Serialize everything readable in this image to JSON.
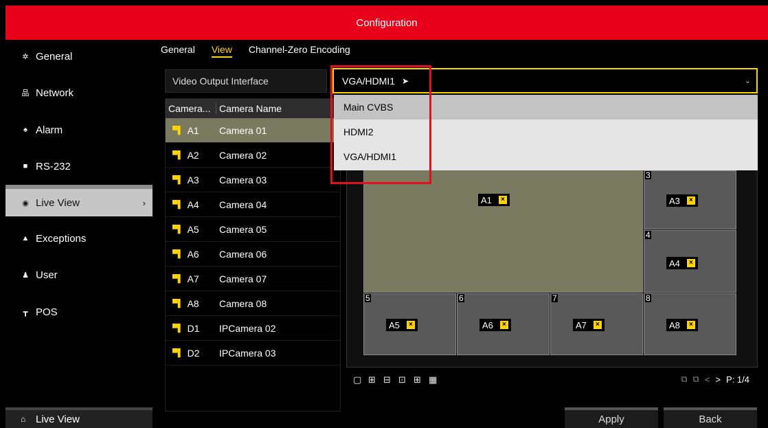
{
  "window": {
    "title": "Configuration"
  },
  "sidebar": {
    "items": [
      {
        "label": "General",
        "icon": "gear-icon"
      },
      {
        "label": "Network",
        "icon": "network-icon"
      },
      {
        "label": "Alarm",
        "icon": "alarm-icon"
      },
      {
        "label": "RS-232",
        "icon": "rs232-icon"
      },
      {
        "label": "Live View",
        "icon": "eye-icon",
        "active": true
      },
      {
        "label": "Exceptions",
        "icon": "warning-icon"
      },
      {
        "label": "User",
        "icon": "users-icon"
      },
      {
        "label": "POS",
        "icon": "pos-icon"
      }
    ],
    "bottom": {
      "label": "Live View",
      "icon": "home-icon"
    }
  },
  "tabs": [
    {
      "label": "General"
    },
    {
      "label": "View",
      "active": true
    },
    {
      "label": "Channel-Zero Encoding"
    }
  ],
  "video_output": {
    "label": "Video Output Interface",
    "selected": "VGA/HDMI1",
    "options": [
      "Main CVBS",
      "HDMI2",
      "VGA/HDMI1"
    ]
  },
  "camera_table": {
    "headers": [
      "Camera...",
      "Camera Name"
    ],
    "rows": [
      {
        "id": "A1",
        "name": "Camera 01",
        "selected": true
      },
      {
        "id": "A2",
        "name": "Camera 02"
      },
      {
        "id": "A3",
        "name": "Camera 03"
      },
      {
        "id": "A4",
        "name": "Camera 04"
      },
      {
        "id": "A5",
        "name": "Camera 05"
      },
      {
        "id": "A6",
        "name": "Camera 06"
      },
      {
        "id": "A7",
        "name": "Camera 07"
      },
      {
        "id": "A8",
        "name": "Camera 08"
      },
      {
        "id": "D1",
        "name": "IPCamera 02"
      },
      {
        "id": "D2",
        "name": "IPCamera 03"
      }
    ]
  },
  "preview": {
    "panes": [
      {
        "num": "",
        "label": "A1"
      },
      {
        "num": "3",
        "label": "A3"
      },
      {
        "num": "4",
        "label": "A4"
      },
      {
        "num": "5",
        "label": "A5"
      },
      {
        "num": "6",
        "label": "A6"
      },
      {
        "num": "7",
        "label": "A7"
      },
      {
        "num": "8",
        "label": "A8"
      }
    ],
    "close_glyph": "×"
  },
  "pager": {
    "prev": "<",
    "next": ">",
    "page": "P: 1/4"
  },
  "buttons": {
    "apply": "Apply",
    "back": "Back"
  },
  "colors": {
    "title_bar": "#e8001b",
    "accent": "#ffd51c",
    "highlight_box": "#e0101e"
  }
}
